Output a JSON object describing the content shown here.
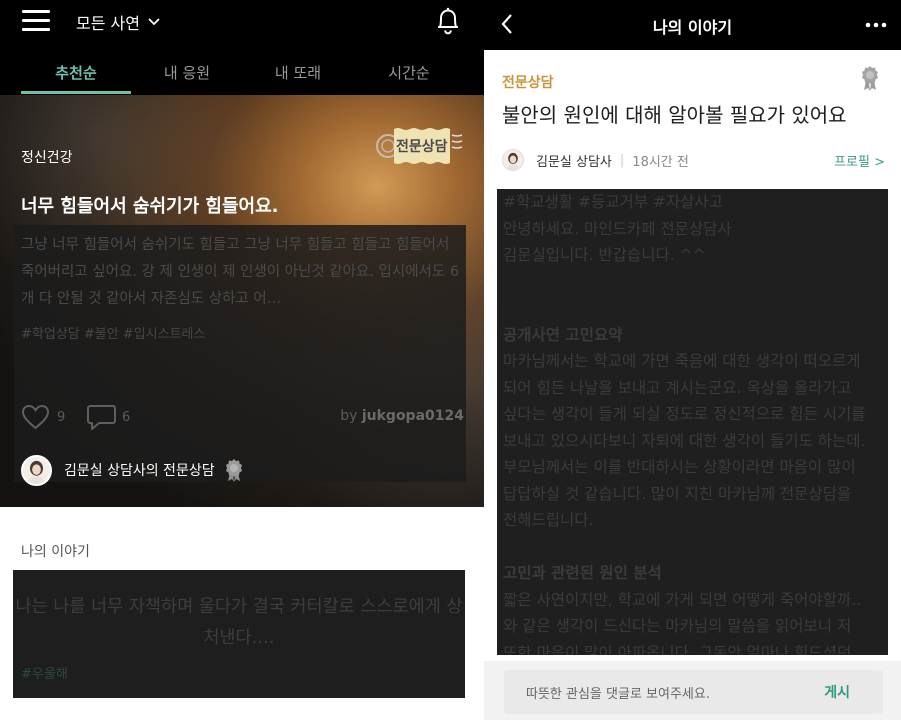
{
  "left": {
    "filter": {
      "label": "모든 사연"
    },
    "tabs": [
      {
        "label": "추천순",
        "active": true
      },
      {
        "label": "내 응원",
        "active": false
      },
      {
        "label": "내 또래",
        "active": false
      },
      {
        "label": "시간순",
        "active": false
      }
    ],
    "card": {
      "category": "정신건강",
      "badge": "전문상담",
      "title": "너무 힘들어서 숨쉬기가 힘들어요.",
      "body": "그냥 너무 힘들어서 숨쉬기도 힘들고 그냥 너무 힘들고 힘들고 힘들어서 죽어버리고 싶어요. 강 제 인생이 제 인생이 아닌것 같아요. 입시에서도 6개 다 안될 것 같아서 자존심도 상하고 어…",
      "tags": "#학업상담 #불안 #입시스트레스",
      "likes": "9",
      "comments": "6",
      "author_prefix": "by ",
      "author": "jukgopa0124",
      "counselor": "김문실 상담사의 전문상담"
    },
    "story_section": {
      "title": "나의 이야기",
      "text": "나는 나를 너무 자책하며 울다가 결국 커터칼로 스스로에게 상처낸다.…",
      "tag": "#우울해"
    }
  },
  "right": {
    "header_title": "나의 이야기",
    "category": "전문상담",
    "title": "불안의 원인에 대해 알아볼 필요가 있어요",
    "author": "김문실 상담사",
    "time": "18시간 전",
    "profile_link": "프로필 >",
    "content": [
      {
        "text": "#학교생활 #등교거부 #자살사고",
        "heading": false
      },
      {
        "text": "안녕하세요. 마인드카페 전문상담사",
        "heading": false
      },
      {
        "text": "김문실입니다. 반갑습니다. ^^",
        "heading": false
      },
      {
        "text": " ",
        "heading": false
      },
      {
        "text": " ",
        "heading": false
      },
      {
        "text": "공개사연 고민요약",
        "heading": true
      },
      {
        "text": "마카님께서는 학교에 가면 죽음에 대한 생각이 떠오르게",
        "heading": false
      },
      {
        "text": "되어 힘든 나날을 보내고 계시는군요. 옥상을 올라가고",
        "heading": false
      },
      {
        "text": "싶다는 생각이 들게 되실 정도로 정신적으로 힘든 시기를",
        "heading": false
      },
      {
        "text": "보내고 있으시다보니 자퇴에 대한 생각이 들기도 하는데.",
        "heading": false
      },
      {
        "text": "부모님께서는 이를 반대하시는 상황이라면 마음이 많이",
        "heading": false
      },
      {
        "text": "답답하실 것 같습니다. 많이 지친 마카님께 전문상담을",
        "heading": false
      },
      {
        "text": "전해드립니다.",
        "heading": false
      },
      {
        "text": " ",
        "heading": false
      },
      {
        "text": "고민과 관련된 원인 분석",
        "heading": true
      },
      {
        "text": "짧은 사연이지만, 학교에 가게 되면 어떻게 죽어야할까..",
        "heading": false
      },
      {
        "text": "와 같은 생각이 드신다는 마카님의 말씀을 읽어보니 저",
        "heading": false
      },
      {
        "text": "또한 마음이 많이 아파옵니다. 그동안 얼마나 힘드셨던",
        "heading": false
      }
    ],
    "comment_placeholder": "따뜻한 관심을 댓글로 보여주세요.",
    "post_label": "게시"
  },
  "colors": {
    "accent_teal": "#6fbfae",
    "category_gold": "#c6973e",
    "link_green": "#3c9a86"
  }
}
